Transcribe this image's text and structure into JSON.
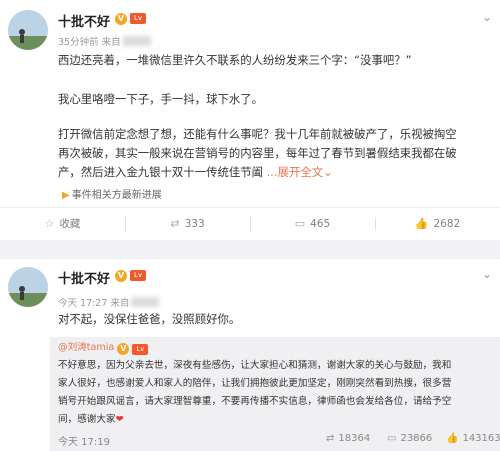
{
  "post1": {
    "username": "十批不好",
    "verified_mark": "V",
    "level_mark": "Lv",
    "time": "35分钟前",
    "source_prefix": "来自",
    "lines": [
      "西边还亮着，一堆微信里许久不联系的人纷纷发来三个字：“没事吧？”",
      "我心里咯噔一下子，手一抖，球下水了。",
      "打开微信前定念想了想，还能有什么事呢？我十几年前就被破产了，乐视被掏空",
      "再次被破，其实一般来说在营销号的内容里，每年过了春节到暑假结束我都在破",
      "产，然后进入金九银十双十一传统佳节阖"
    ],
    "expand_label": "展开全文",
    "expand_arrow": "⌄",
    "topic_label": "事件相关方最新进展",
    "actions": {
      "favorite": "收藏",
      "repost": "333",
      "comment": "465",
      "like": "2682"
    }
  },
  "post2": {
    "username": "十批不好",
    "verified_mark": "V",
    "level_mark": "Lv",
    "time": "今天 17:27",
    "source_prefix": "来自",
    "text": "对不起，没保住爸爸，没照顾好你。",
    "quoted": {
      "author": "@刘涛tamia",
      "lines": [
        "不好意思，因为父亲去世，深夜有些感伤，让大家担心和猜测，谢谢大家的关心与鼓励，我和",
        "家人很好，也感谢爱人和家人的陪伴，让我们拥抱彼此更加坚定，刚刚突然看到热搜，很多营",
        "销号开始跟风谣言，请大家理智尊重，不要再传播不实信息，律师函也会发给各位，请给予空",
        "间，感谢大家"
      ],
      "heart": "❤",
      "time": "今天 17:19",
      "actions": {
        "repost": "18364",
        "comment": "23866",
        "like": "143163"
      }
    }
  },
  "icons": {
    "chevron": "⌄",
    "favorite": "☆",
    "repost": "⇄",
    "comment": "▭",
    "like": "👍"
  }
}
